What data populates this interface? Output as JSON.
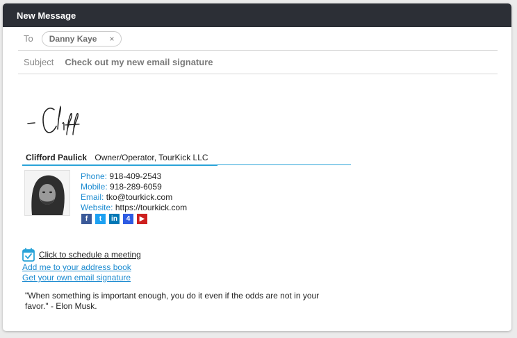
{
  "window": {
    "title": "New Message"
  },
  "recipients": {
    "label": "To",
    "chips": [
      {
        "name": "Danny Kaye",
        "remove": "×"
      }
    ]
  },
  "subject": {
    "label": "Subject",
    "value": "Check out my new email signature"
  },
  "signature": {
    "handwritten": "- Cliff",
    "name": "Clifford Paulick",
    "title": "Owner/Operator, TourKick LLC",
    "contacts": [
      {
        "label": "Phone:",
        "value": "918-409-2543"
      },
      {
        "label": "Mobile:",
        "value": "918-289-6059"
      },
      {
        "label": "Email:",
        "value": "tko@tourkick.com"
      },
      {
        "label": "Website:",
        "value": "https://tourkick.com"
      }
    ],
    "socials": [
      {
        "icon": "facebook-icon",
        "glyph": "f",
        "color": "#3b5998"
      },
      {
        "icon": "twitter-icon",
        "glyph": "t",
        "color": "#1da1f2"
      },
      {
        "icon": "linkedin-icon",
        "glyph": "in",
        "color": "#0077b5"
      },
      {
        "icon": "foursquare-icon",
        "glyph": "4",
        "color": "#2d5be3"
      },
      {
        "icon": "youtube-icon",
        "glyph": "▶",
        "color": "#cd201f"
      }
    ],
    "schedule_link": "Click to schedule a meeting",
    "address_book_link": "Add me to your address book",
    "own_signature_link": "Get your own email signature",
    "quote": "\"When something is important enough, you do it even if the odds are not in your favor.\" - Elon Musk."
  },
  "colors": {
    "accent": "#29a3d8",
    "link": "#1a8ad0",
    "titlebar": "#2c2f36"
  }
}
